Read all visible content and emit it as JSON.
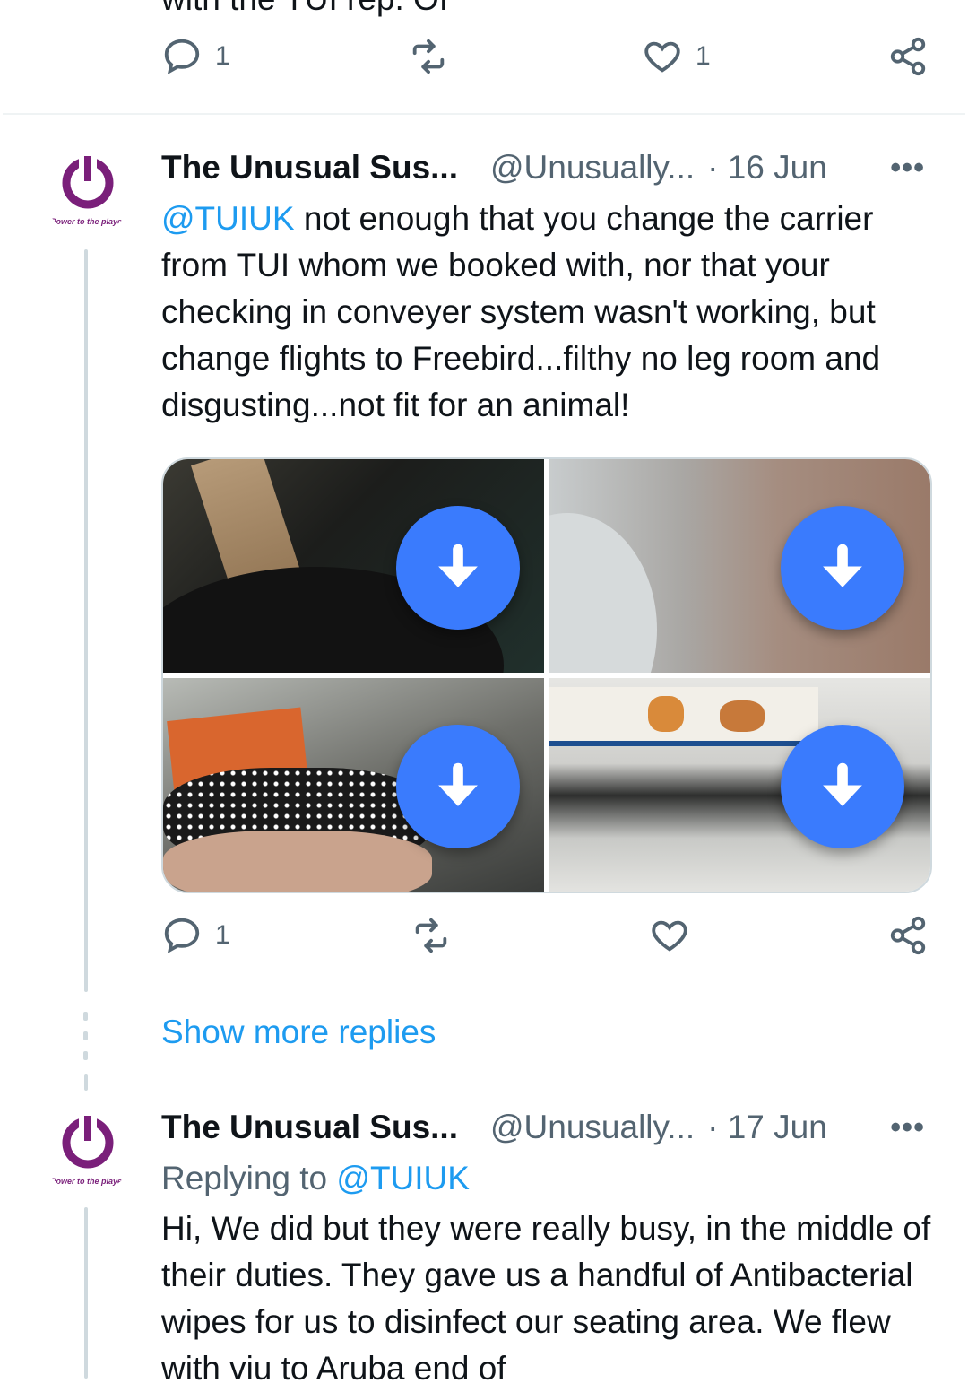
{
  "prev_tweet": {
    "clipped_text": "with the TUI rep. Of",
    "actions": {
      "replies": "1",
      "likes": "1"
    }
  },
  "tweet1": {
    "author_name": "The Unusual Sus...",
    "handle": "@Unusually...",
    "date": "· 16 Jun",
    "more": "•••",
    "mention": "@TUIUK",
    "text": " not enough that you change the carrier from TUI whom we booked with, nor that your checking in conveyer system wasn't working, but change flights to Freebird...filthy no leg room and disgusting...not fit for an animal!",
    "avatar_tagline": "Power to the player",
    "media_count": 4,
    "actions": {
      "replies": "1"
    }
  },
  "show_more_replies": "Show more replies",
  "tweet2": {
    "author_name": "The Unusual Sus...",
    "handle": "@Unusually...",
    "date": "· 17 Jun",
    "more": "•••",
    "replying_prefix": "Replying to ",
    "replying_to": "@TUIUK",
    "text": "Hi, We did but they were really busy, in the middle of their duties. They gave us a handful of Antibacterial wipes for us to disinfect our seating area. We flew with viu to Aruba end of",
    "avatar_tagline": "Power to the player"
  },
  "colors": {
    "accent": "#1d9bf0",
    "download_button": "#3a7bfd",
    "avatar_purple": "#7a1f7a",
    "muted": "#536471"
  },
  "icons": [
    "reply-icon",
    "retweet-icon",
    "like-icon",
    "share-icon",
    "more-icon",
    "download-icon",
    "power-icon"
  ]
}
